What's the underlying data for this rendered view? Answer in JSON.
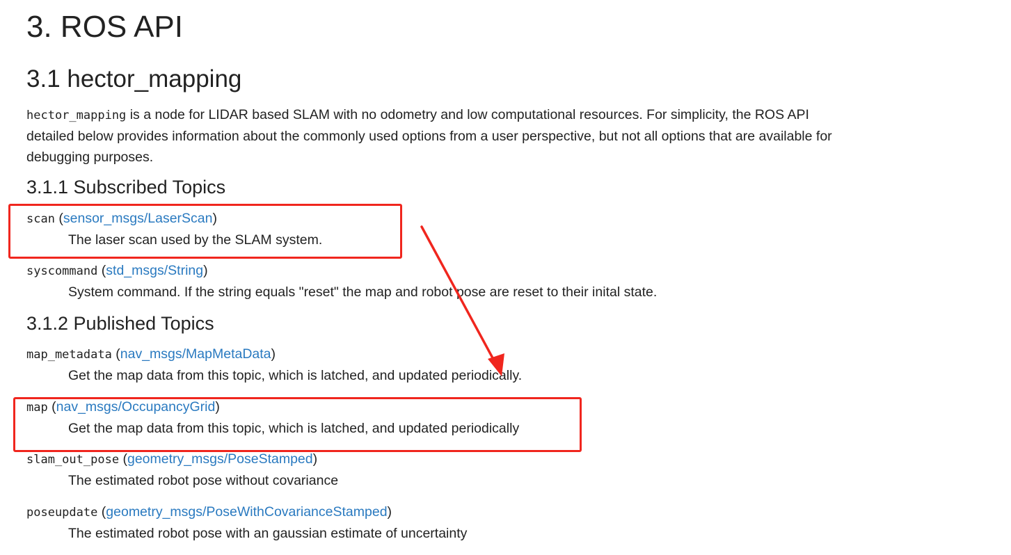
{
  "title": "3. ROS API",
  "section": {
    "heading": "3.1 hector_mapping",
    "intro_code": "hector_mapping",
    "intro_text": " is a node for LIDAR based SLAM with no odometry and low computational resources. For simplicity, the ROS API detailed below provides information about the commonly used options from a user perspective, but not all options that are available for debugging purposes."
  },
  "subscribed": {
    "heading": "3.1.1 Subscribed Topics",
    "topics": [
      {
        "name": "scan",
        "type": "sensor_msgs/LaserScan",
        "description": "The laser scan used by the SLAM system."
      },
      {
        "name": "syscommand",
        "type": "std_msgs/String",
        "description": "System command. If the string equals \"reset\" the map and robot pose are reset to their inital state."
      }
    ]
  },
  "published": {
    "heading": "3.1.2 Published Topics",
    "topics": [
      {
        "name": "map_metadata",
        "type": "nav_msgs/MapMetaData",
        "description": "Get the map data from this topic, which is latched, and updated periodically."
      },
      {
        "name": "map",
        "type": "nav_msgs/OccupancyGrid",
        "description": "Get the map data from this topic, which is latched, and updated periodically"
      },
      {
        "name": "slam_out_pose",
        "type": "geometry_msgs/PoseStamped",
        "description": "The estimated robot pose without covariance"
      },
      {
        "name": "poseupdate",
        "type": "geometry_msgs/PoseWithCovarianceStamped",
        "description": "The estimated robot pose with an gaussian estimate of uncertainty"
      }
    ]
  },
  "punct": {
    "open": " (",
    "close": ")"
  },
  "annotation": {
    "color": "#f0261e"
  }
}
